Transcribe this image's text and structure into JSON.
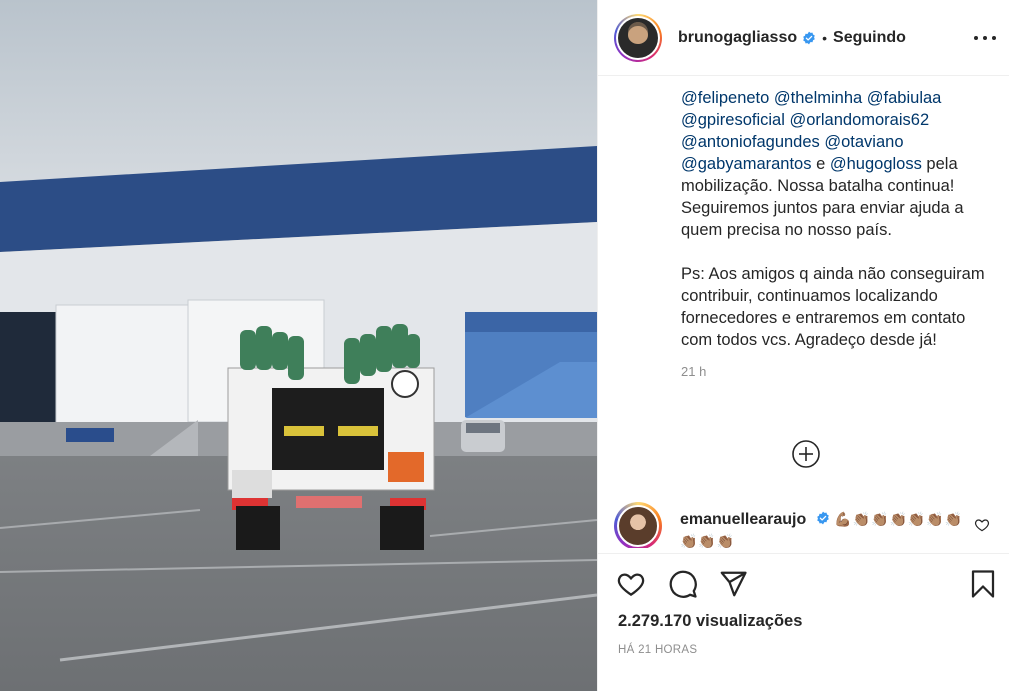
{
  "post": {
    "username": "brunogagliasso",
    "separator": "•",
    "follow_status": "Seguindo",
    "caption_lines": {
      "l1": "@felipeneto",
      "l1b": "@thelminha",
      "l1c": "@fabiulaa",
      "l2a": "@gpiresoficial",
      "l2b": "@orlandomorais62",
      "l3a": "@antoniofagundes",
      "l3b": "@otaviano",
      "l4a": "@gabyamarantos",
      "l4b": " e ",
      "l4c": "@hugogloss",
      "l4d": " pela",
      "p1": "mobilização. Nossa batalha continua! Seguiremos juntos para enviar ajuda a quem precisa no nosso país.",
      "p2": "Ps: Aos amigos q ainda não conseguiram contribuir, continuamos localizando fornecedores e entraremos em contato com todos vcs. Agradeço desde já!"
    },
    "caption_time": "21 h",
    "views": "2.279.170 visualizações",
    "time_ago": "HÁ 21 HORAS"
  },
  "comment": {
    "username": "emanuellearaujo",
    "text": "💪🏽👏🏽👏🏽👏🏽👏🏽👏🏽👏🏽👏🏽👏🏽👏🏽"
  },
  "icons": {
    "verified": "verified-badge-icon",
    "more": "more-options-icon",
    "load_more": "plus-circle-icon",
    "like": "heart-icon",
    "comment": "comment-icon",
    "share": "paper-plane-icon",
    "save": "bookmark-icon",
    "comment_like": "heart-small-icon"
  },
  "colors": {
    "verified_blue": "#3897f0",
    "mention": "#00376b",
    "text": "#262626",
    "muted": "#8e8e8e"
  }
}
